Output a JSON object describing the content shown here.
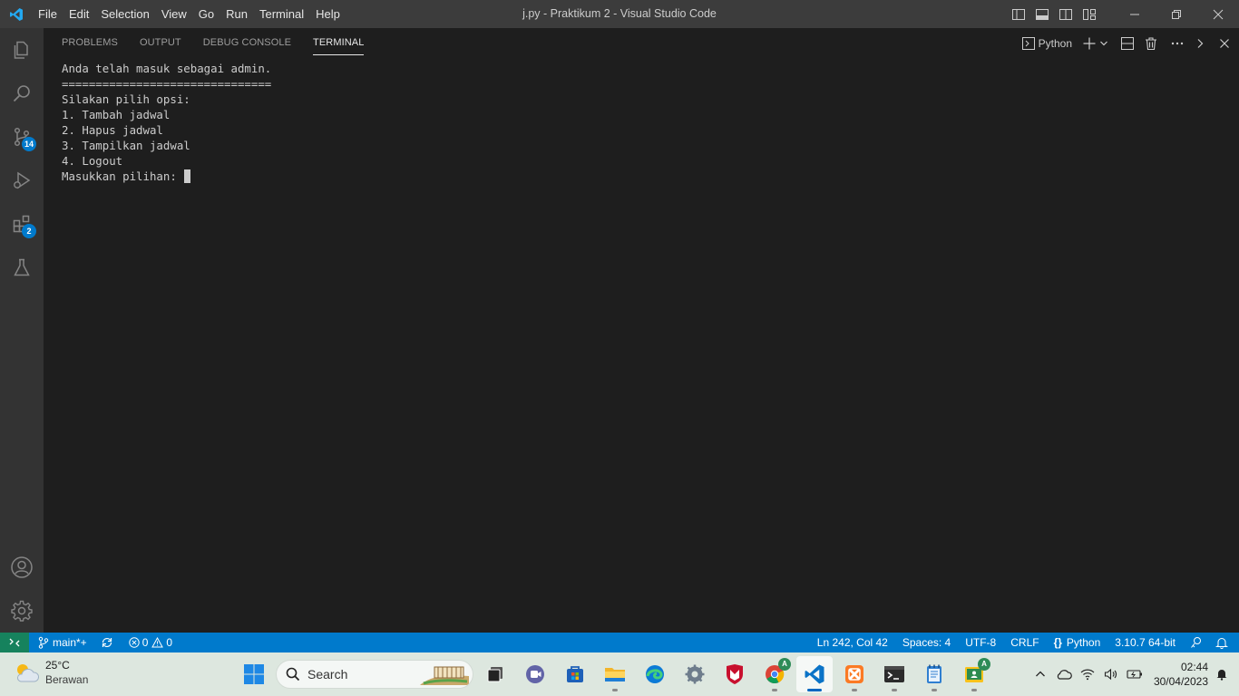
{
  "window": {
    "title": "j.py - Praktikum 2 - Visual Studio Code"
  },
  "menu": [
    "File",
    "Edit",
    "Selection",
    "View",
    "Go",
    "Run",
    "Terminal",
    "Help"
  ],
  "activity": {
    "source_control_badge": "14",
    "extensions_badge": "2"
  },
  "panel": {
    "tabs": [
      "PROBLEMS",
      "OUTPUT",
      "DEBUG CONSOLE",
      "TERMINAL"
    ],
    "active_tab": "TERMINAL",
    "terminal_profile": "Python"
  },
  "terminal": {
    "lines": [
      "Anda telah masuk sebagai admin.",
      "===============================",
      "",
      "Silakan pilih opsi:",
      "1. Tambah jadwal",
      "2. Hapus jadwal",
      "3. Tampilkan jadwal",
      "4. Logout",
      "",
      "Masukkan pilihan: "
    ]
  },
  "statusbar": {
    "branch": "main*+",
    "errors": "0",
    "warnings": "0",
    "position": "Ln 242, Col 42",
    "spaces": "Spaces: 4",
    "encoding": "UTF-8",
    "eol": "CRLF",
    "language": "Python",
    "interpreter": "3.10.7 64-bit"
  },
  "taskbar": {
    "weather_temp": "25°C",
    "weather_desc": "Berawan",
    "search_label": "Search",
    "time": "02:44",
    "date": "30/04/2023",
    "badge_letter": "A"
  },
  "colors": {
    "accent": "#007acc",
    "remote": "#16825d",
    "titlebar": "#3c3c3c",
    "activitybar": "#333333",
    "editor_bg": "#1e1e1e"
  }
}
